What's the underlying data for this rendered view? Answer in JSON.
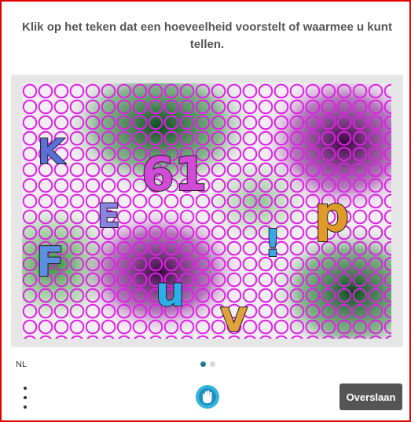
{
  "challenge": {
    "prompt": "Klik op het teken dat een hoeveelheid voorstelt of waarmee u kunt tellen.",
    "glyphs": [
      {
        "name": "glyph-k",
        "text": "K",
        "color": "#5b6fd8"
      },
      {
        "name": "glyph-61",
        "text": "61",
        "color": "#d24ad8"
      },
      {
        "name": "glyph-e",
        "text": "E",
        "color": "#8a82e0"
      },
      {
        "name": "glyph-p",
        "text": "p",
        "color": "#e09a2a"
      },
      {
        "name": "glyph-f",
        "text": "F",
        "color": "#5b8fe0"
      },
      {
        "name": "glyph-exclaim",
        "text": "!",
        "color": "#39a8e8"
      },
      {
        "name": "glyph-u",
        "text": "u",
        "color": "#2ab0e8"
      },
      {
        "name": "glyph-v",
        "text": "v",
        "color": "#e0a23a"
      }
    ]
  },
  "footer": {
    "language": "NL",
    "skip_label": "Overslaan",
    "menu_icon": "more-vertical-icon",
    "accessibility_icon": "hand-icon"
  },
  "pager": {
    "total": 2,
    "active": 1
  },
  "colors": {
    "border": "#e10000",
    "accent": "#1b7c8b",
    "button": "#555555",
    "ring": "#e020e8"
  }
}
